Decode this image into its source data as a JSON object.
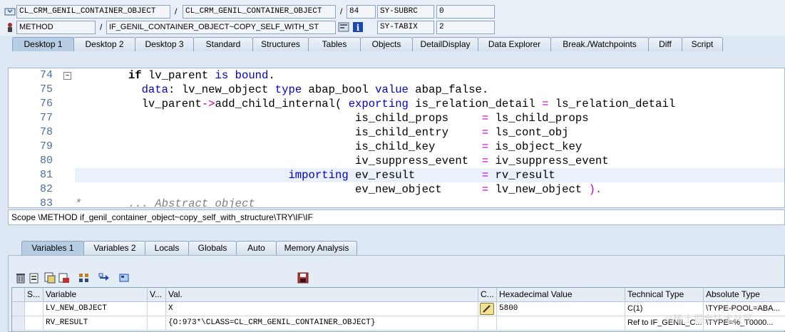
{
  "header": {
    "row1": {
      "program": "CL_CRM_GENIL_CONTAINER_OBJECT",
      "include": "CL_CRM_GENIL_CONTAINER_OBJECT",
      "line": "84",
      "sysvar_name": "SY-SUBRC",
      "sysvar_value": "0"
    },
    "row2": {
      "type": "METHOD",
      "name": "IF_GENIL_CONTAINER_OBJECT~COPY_SELF_WITH_ST",
      "sysvar_name": "SY-TABIX",
      "sysvar_value": "2"
    },
    "slash": "/"
  },
  "desktop_tabs": [
    "Desktop 1",
    "Desktop 2",
    "Desktop 3",
    "Standard",
    "Structures",
    "Tables",
    "Objects",
    "DetailDisplay",
    "Data Explorer",
    "Break./Watchpoints",
    "Diff",
    "Script"
  ],
  "code": {
    "line_numbers": [
      "74",
      "75",
      "76",
      "77",
      "78",
      "79",
      "80",
      "81",
      "82",
      "83"
    ],
    "l74": {
      "kw1": "if",
      "t1": " lv_parent ",
      "kw2": "is bound",
      "t2": "."
    },
    "l75": {
      "kw1": "data",
      "t1": ": lv_new_object ",
      "kw2": "type",
      "t2": " abap_bool ",
      "kw3": "value",
      "t3": " abap_false."
    },
    "l76": {
      "t1": "lv_parent",
      "op1": "->",
      "t2": "add_child_internal( ",
      "kw1": "exporting",
      "t3": " is_relation_detail ",
      "op2": "=",
      "t4": " ls_relation_detail"
    },
    "l77": {
      "t1": "is_child_props     ",
      "op": "=",
      "t2": " ls_child_props"
    },
    "l78": {
      "t1": "is_child_entry     ",
      "op": "=",
      "t2": " ls_cont_obj"
    },
    "l79": {
      "t1": "is_child_key       ",
      "op": "=",
      "t2": " is_object_key"
    },
    "l80": {
      "t1": "iv_suppress_event  ",
      "op": "=",
      "t2": " iv_suppress_event"
    },
    "l81": {
      "kw": "importing",
      "t1": " ev_result          ",
      "op": "=",
      "t2": " rv_result"
    },
    "l82": {
      "t1": "ev_new_object      ",
      "op": "=",
      "t2": " lv_new_object ",
      "t3": ")."
    },
    "l83": {
      "star": "*",
      "cm": "... Abstract object"
    }
  },
  "scope": "Scope \\METHOD if_genil_container_object~copy_self_with_structure\\TRY\\IF\\IF",
  "var_tabs": [
    "Variables 1",
    "Variables 2",
    "Locals",
    "Globals",
    "Auto",
    "Memory Analysis"
  ],
  "grid": {
    "headers": [
      "S...",
      "Variable",
      "V...",
      "Val.",
      "C...",
      "Hexadecimal Value",
      "Technical Type",
      "Absolute Type"
    ],
    "rows": [
      {
        "variable": "LV_NEW_OBJECT",
        "value": "X",
        "hex": "5800",
        "tech": "C(1)",
        "abs": "\\TYPE-POOL=ABA..."
      },
      {
        "variable": "RV_RESULT",
        "value": "{O:973*\\CLASS=CL_CRM_GENIL_CONTAINER_OBJECT}",
        "hex": "",
        "tech": "Ref to IF_GENIL_C...",
        "abs": "\\TYPE=%_T0000..."
      }
    ]
  },
  "watermark": "@稀土掘金技术社区",
  "icons": [
    "expand-icon",
    "method-icon",
    "navigate-icon",
    "info-icon",
    "delete-icon",
    "save-icon",
    "pencil-icon"
  ]
}
